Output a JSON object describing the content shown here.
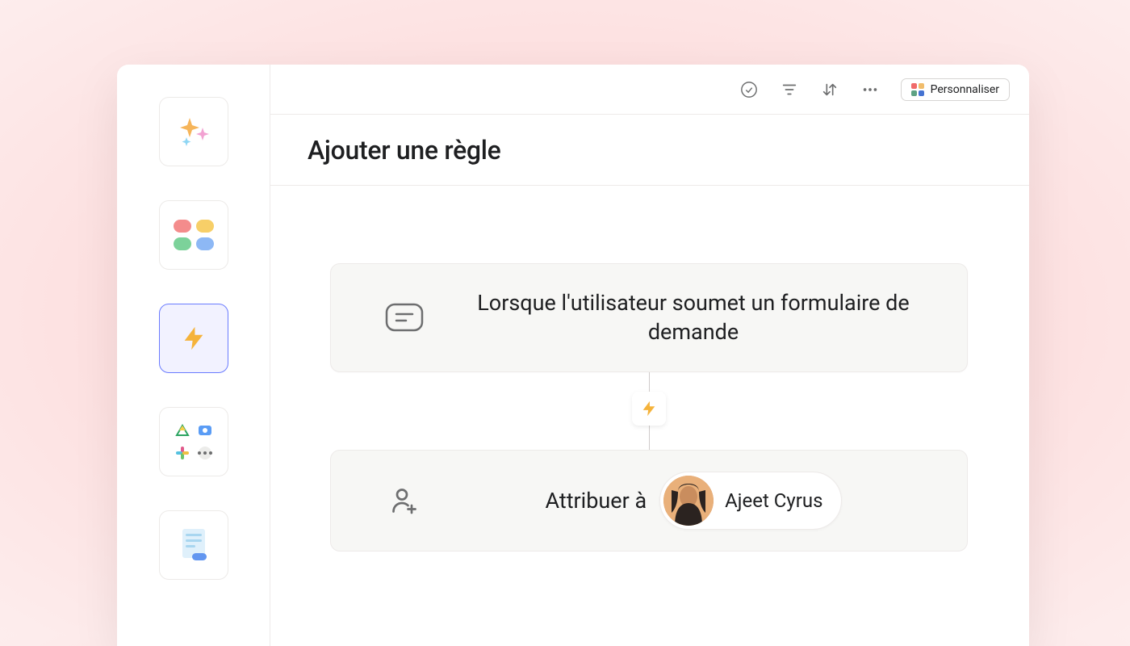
{
  "topbar": {
    "customize_label": "Personnaliser"
  },
  "page": {
    "title": "Ajouter une règle"
  },
  "rule": {
    "trigger_text": "Lorsque l'utilisateur soumet un formulaire de demande",
    "action_label": "Attribuer à",
    "assignee_name": "Ajeet Cyrus"
  },
  "sidebar": {
    "items": [
      {
        "name": "ai-sparkles"
      },
      {
        "name": "fields-colors"
      },
      {
        "name": "rules-bolt",
        "selected": true
      },
      {
        "name": "apps-integrations"
      },
      {
        "name": "forms-doc"
      }
    ]
  }
}
